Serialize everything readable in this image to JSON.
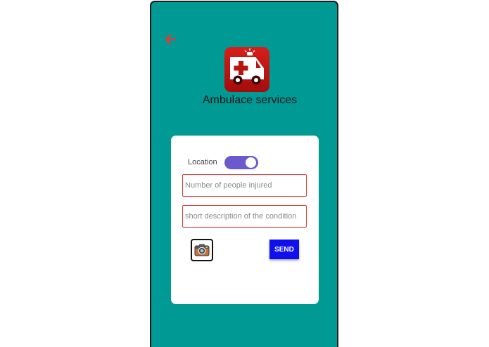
{
  "header": {
    "back_icon": "arrow-left-icon",
    "logo_icon": "ambulance-icon",
    "title": "Ambulace services"
  },
  "form": {
    "location_label": "Location",
    "location_enabled": true,
    "injured_placeholder": "Number of people injured",
    "injured_value": "",
    "description_placeholder": "short description of the condition",
    "description_value": "",
    "camera_icon": "camera-icon",
    "send_label": "SEND"
  },
  "colors": {
    "background": "#009994",
    "toggle": "#6a5acd",
    "send_button": "#1010ee",
    "field_border": "#e53935",
    "back_arrow": "#e53935",
    "logo": "#c4110f"
  }
}
